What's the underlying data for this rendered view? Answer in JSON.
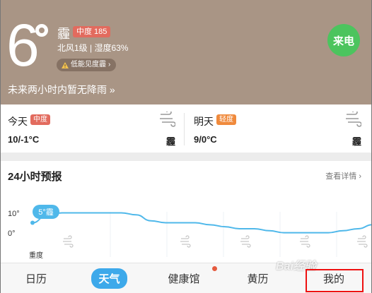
{
  "header": {
    "temperature": "6",
    "condition": "霾",
    "aqi_badge": "中度 185",
    "wind_humidity": "北风1级 | 湿度63%",
    "visibility": "低能见度霾",
    "rain_forecast": "未来两小时内暂无降雨 »",
    "power_badge": "来电",
    "colors": {
      "background": "#a99585",
      "aqi": "#e26b5e",
      "power": "#4cc45e"
    }
  },
  "days": [
    {
      "name": "今天",
      "badge": "中度",
      "badge_color": "#e26b5e",
      "temps": "10/-1°C",
      "condition": "霾"
    },
    {
      "name": "明天",
      "badge": "轻度",
      "badge_color": "#f08a3c",
      "temps": "9/0°C",
      "condition": "霾"
    }
  ],
  "forecast": {
    "title": "24小时预报",
    "detail_link": "查看详情 ›",
    "bubble": "5°霾",
    "aqi_label": "重度"
  },
  "chart_data": {
    "type": "line",
    "y_ticks": [
      "10°",
      "0°"
    ],
    "ylim": [
      -3,
      13
    ],
    "values": [
      5,
      9,
      10,
      10,
      10,
      10,
      10,
      9,
      6,
      5,
      5,
      5,
      4,
      3,
      2,
      2,
      1,
      0,
      0,
      0,
      0,
      1,
      2,
      4
    ],
    "line_color": "#4fb8ea"
  },
  "tabs": [
    {
      "label": "日历",
      "active": false
    },
    {
      "label": "天气",
      "active": true
    },
    {
      "label": "健康馆",
      "active": false
    },
    {
      "label": "黄历",
      "active": false
    },
    {
      "label": "我的",
      "active": false
    }
  ],
  "watermark": "Bai经验"
}
